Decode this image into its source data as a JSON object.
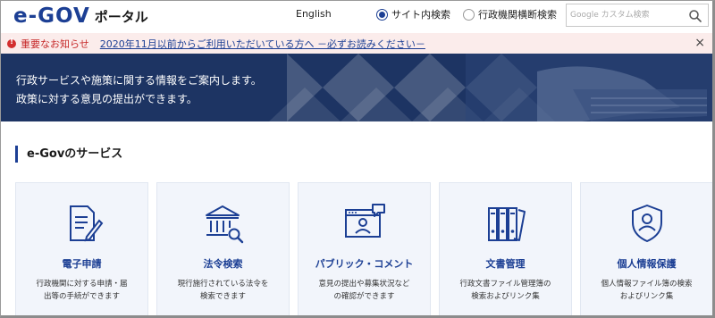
{
  "header": {
    "logo_mark": "e-GOV",
    "logo_text": "ポータル",
    "lang_link": "English",
    "radio_site_search": "サイト内検索",
    "radio_cross_search": "行政機関横断検索",
    "search_placeholder": "Google カスタム検索"
  },
  "notice": {
    "label": "重要なお知らせ",
    "link_text": "2020年11月以前からご利用いただいている方へ －必ずお読みください－",
    "close": "×"
  },
  "hero": {
    "line1": "行政サービスや施策に関する情報をご案内します。",
    "line2": "政策に対する意見の提出ができます。"
  },
  "section": {
    "title": "e-Govのサービス"
  },
  "cards": [
    {
      "title": "電子申請",
      "desc1": "行政機関に対する申請・届",
      "desc2": "出等の手続ができます",
      "icon": "document-pen-icon"
    },
    {
      "title": "法令検索",
      "desc1": "現行施行されている法令を",
      "desc2": "検索できます",
      "icon": "building-search-icon"
    },
    {
      "title": "パブリック・コメント",
      "desc1": "意見の提出や募集状況など",
      "desc2": "の確認ができます",
      "icon": "browser-comment-icon"
    },
    {
      "title": "文書管理",
      "desc1": "行政文書ファイル管理簿の",
      "desc2": "検索およびリンク集",
      "icon": "binders-icon"
    },
    {
      "title": "個人情報保護",
      "desc1": "個人情報ファイル簿の検索",
      "desc2": "およびリンク集",
      "icon": "shield-person-icon"
    }
  ],
  "colors": {
    "brand": "#1c3f94",
    "hero_bg": "#1d3463",
    "notice_bg": "#fbeceb",
    "alert": "#d32f2f",
    "card_bg": "#f2f5fb"
  }
}
